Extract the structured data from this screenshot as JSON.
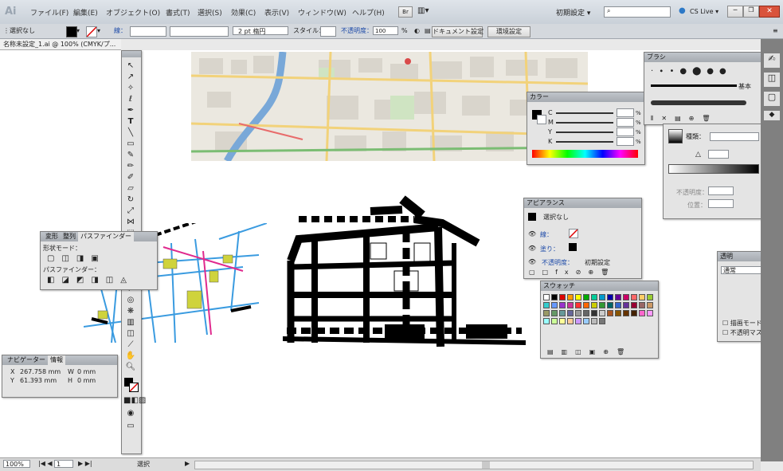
{
  "app": {
    "logo": "Ai"
  },
  "menu": [
    "ファイル(F)",
    "編集(E)",
    "オブジェクト(O)",
    "書式(T)",
    "選択(S)",
    "効果(C)",
    "表示(V)",
    "ウィンドウ(W)",
    "ヘルプ(H)"
  ],
  "menubar_right": {
    "br": "Br",
    "workspace": "初期設定 ▾",
    "cslive": "CS Live ▾"
  },
  "control": {
    "selection": "選択なし",
    "stroke_label": "線：",
    "stroke_weight_value": "2 pt 楕円",
    "style_label": "スタイル：",
    "opacity_label": "不透明度：",
    "opacity_value": "100",
    "opacity_unit": "%",
    "doc_setup": "ドキュメント設定",
    "prefs": "環境設定"
  },
  "document_tab": "名称未設定_1.ai @ 100% (CMYK/プ...",
  "panels": {
    "brush": {
      "title": "ブラシ",
      "basic": "基本"
    },
    "color": {
      "title": "カラー",
      "channels": [
        "C",
        "M",
        "Y",
        "K"
      ],
      "unit": "%"
    },
    "gradient": {
      "type_label": "種類：",
      "angle_label": "不透明度：",
      "position_label": "位置："
    },
    "appearance": {
      "title": "アピアランス",
      "none": "選択なし",
      "stroke": "線：",
      "fill": "塗り：",
      "opacity": "不透明度：",
      "opacity_value": "初期設定"
    },
    "swatch": {
      "title": "スウォッチ"
    },
    "transparency": {
      "title": "透明",
      "mode": "通常",
      "knockout": "描画モードを分離",
      "opacity_mask": "不透明マスクで形状"
    },
    "pathfinder": {
      "tabs": [
        "変形",
        "整列",
        "パスファインダー"
      ],
      "shape_mode": "形状モード：",
      "pathfinder_label": "パスファインダー："
    },
    "navigator": {
      "tabs": [
        "ナビゲーター",
        "情報"
      ],
      "x_label": "X",
      "x_value": "267.758 mm",
      "y_label": "Y",
      "y_value": "61.393 mm",
      "w_label": "W",
      "w_value": "0 mm",
      "h_label": "H",
      "h_value": "0 mm"
    }
  },
  "status": {
    "zoom": "100%",
    "page": "1",
    "status_text": "選択"
  }
}
